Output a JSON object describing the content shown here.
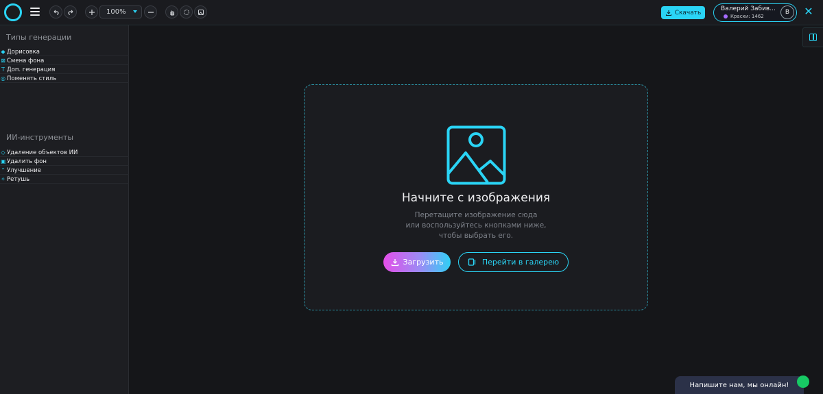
{
  "toolbar": {
    "zoom_value": "100%",
    "download_label": "Скачать"
  },
  "user": {
    "name": "Валерий Забив...",
    "coins": "Краски: 1462",
    "avatar_letter": "В"
  },
  "sidebar": {
    "gen_title": "Типы генерации",
    "gen_items": [
      "Дорисовка",
      "Смена фона",
      "Доп. генерация",
      "Поменять стиль"
    ],
    "ai_title": "ИИ-инструменты",
    "ai_items": [
      "Удаление объектов ИИ",
      "Удалить фон",
      "Улучшение",
      "Ретушь"
    ]
  },
  "dropzone": {
    "title": "Начните с изображения",
    "subtitle_line1": "Перетащите изображение сюда",
    "subtitle_line2": "или воспользуйтесь кнопками ниже,",
    "subtitle_line3": "чтобы выбрать его.",
    "upload_label": "Загрузить",
    "gallery_label": "Перейти в галерею"
  },
  "chat": {
    "label": "Напишите нам, мы онлайн!"
  },
  "colors": {
    "accent": "#2ad4f5",
    "background": "#151619"
  }
}
